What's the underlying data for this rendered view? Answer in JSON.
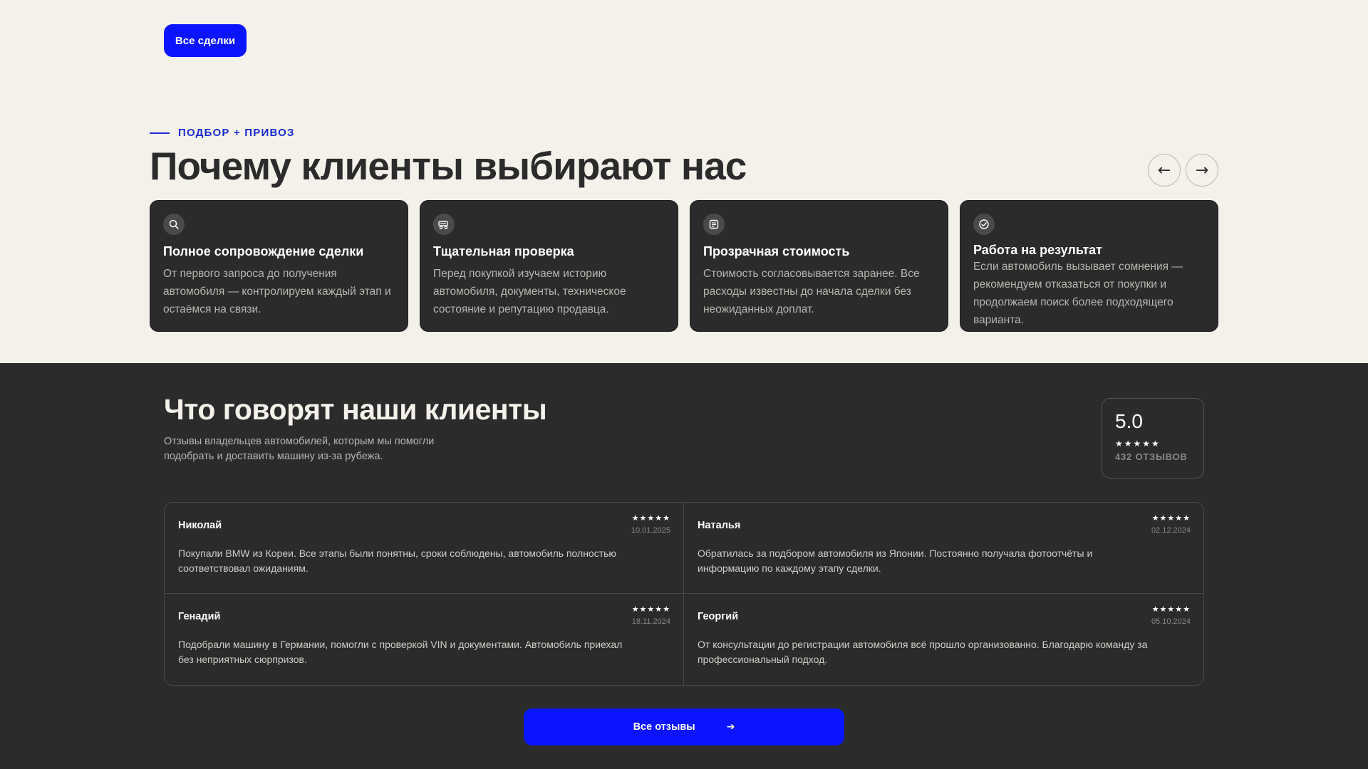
{
  "top": {
    "deals_button": "Все сделки",
    "eyebrow": "ПОДБОР + ПРИВОЗ",
    "title": "Почему клиенты выбирают нас",
    "nav_prev": "←",
    "nav_next": "→",
    "cards": [
      {
        "icon": "search-icon",
        "title": "Полное сопровождение сделки",
        "text": "От первого запроса до получения автомобиля — контролируем каждый этап и остаёмся на связи."
      },
      {
        "icon": "car-check-icon",
        "title": "Тщательная проверка",
        "text": "Перед покупкой изучаем историю автомобиля, документы, техническое состояние и репутацию продавца."
      },
      {
        "icon": "document-icon",
        "title": "Прозрачная стоимость",
        "text": "Стоимость согласовывается заранее. Все расходы известны до начала сделки без неожиданных доплат."
      },
      {
        "icon": "check-circle-icon",
        "title": "Работа на результат",
        "text": "Если автомобиль вызывает сомнения — рекомендуем отказаться от покупки и продолжаем поиск более подходящего варианта."
      }
    ]
  },
  "reviews_section": {
    "title": "Что говорят наши клиенты",
    "subtitle": "Отзывы владельцев автомобилей, которым мы помогли подобрать и доставить машину из-за рубежа.",
    "rating": {
      "value": "5.0",
      "stars": "★★★★★",
      "count": "432 ОТЗЫВОВ"
    },
    "reviews": [
      {
        "name": "Николай",
        "stars": "★★★★★",
        "date": "10.01.2025",
        "text": "Покупали BMW из Кореи. Все этапы были понятны, сроки соблюдены, автомобиль полностью соответствовал ожиданиям."
      },
      {
        "name": "Наталья",
        "stars": "★★★★★",
        "date": "02.12.2024",
        "text": "Обратилась за подбором автомобиля из Японии. Постоянно получала фотоотчёты и информацию по каждому этапу сделки."
      },
      {
        "name": "Генадий",
        "stars": "★★★★★",
        "date": "18.11.2024",
        "text": "Подобрали машину в Германии, помогли с проверкой VIN и документами. Автомобиль приехал без неприятных сюрпризов."
      },
      {
        "name": "Георгий",
        "stars": "★★★★★",
        "date": "05.10.2024",
        "text": "От консультации до регистрации автомобиля всё прошло организованно. Благодарю команду за профессиональный подход."
      }
    ],
    "all_button": "Все отзывы",
    "all_button_arrow": "➔"
  },
  "colors": {
    "accent": "#0a14ff",
    "light_bg": "#f3f1ea",
    "dark_bg": "#2b2b2b"
  }
}
